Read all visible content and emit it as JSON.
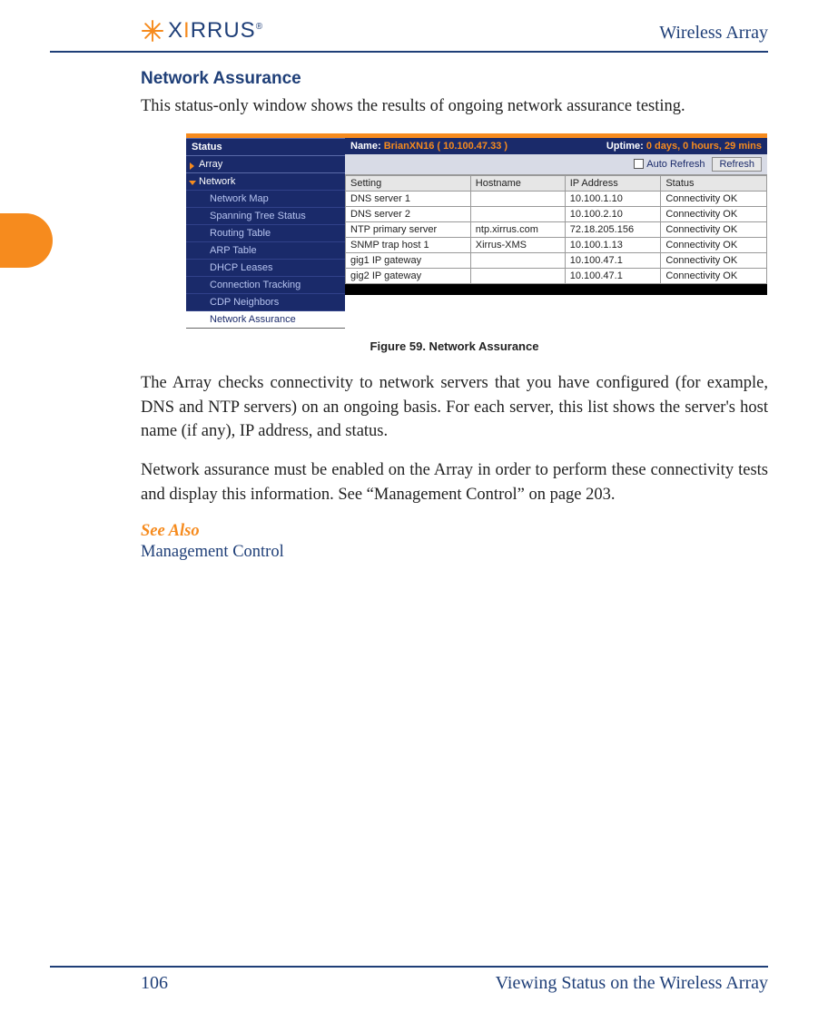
{
  "header": {
    "logo_text": "XIRRUS",
    "doc_title": "Wireless Array"
  },
  "section": {
    "title": "Network Assurance",
    "intro": "This status-only window shows the results of ongoing network assurance testing."
  },
  "figure": {
    "caption": "Figure 59. Network Assurance",
    "nav": {
      "heading": "Status",
      "item_array": "Array",
      "item_network": "Network",
      "subitems": [
        "Network Map",
        "Spanning Tree Status",
        "Routing Table",
        "ARP Table",
        "DHCP Leases",
        "Connection Tracking",
        "CDP Neighbors",
        "Network Assurance"
      ]
    },
    "pane": {
      "name_label": "Name:",
      "name_value": "BrianXN16   ( 10.100.47.33 )",
      "uptime_label": "Uptime:",
      "uptime_value": "0 days, 0 hours, 29 mins",
      "auto_refresh": "Auto Refresh",
      "refresh_btn": "Refresh",
      "columns": [
        "Setting",
        "Hostname",
        "IP Address",
        "Status"
      ],
      "rows": [
        {
          "setting": "DNS server 1",
          "host": "",
          "ip": "10.100.1.10",
          "status": "Connectivity OK"
        },
        {
          "setting": "DNS server 2",
          "host": "",
          "ip": "10.100.2.10",
          "status": "Connectivity OK"
        },
        {
          "setting": "NTP primary server",
          "host": "ntp.xirrus.com",
          "ip": "72.18.205.156",
          "status": "Connectivity OK"
        },
        {
          "setting": "SNMP trap host 1",
          "host": "Xirrus-XMS",
          "ip": "10.100.1.13",
          "status": "Connectivity OK"
        },
        {
          "setting": "gig1 IP gateway",
          "host": "",
          "ip": "10.100.47.1",
          "status": "Connectivity OK"
        },
        {
          "setting": "gig2 IP gateway",
          "host": "",
          "ip": "10.100.47.1",
          "status": "Connectivity OK"
        }
      ]
    }
  },
  "paras": {
    "p2": "The Array checks connectivity to network servers that you have configured (for example, DNS and NTP servers) on an ongoing basis. For each server, this list shows the server's host name (if any), IP address, and status.",
    "p3": "Network assurance must be enabled on the Array in order to perform these connectivity tests and display this information. See “Management Control” on page 203."
  },
  "seealso": {
    "label": "See Also",
    "link": "Management Control"
  },
  "footer": {
    "page": "106",
    "chapter": "Viewing Status on the Wireless Array"
  }
}
